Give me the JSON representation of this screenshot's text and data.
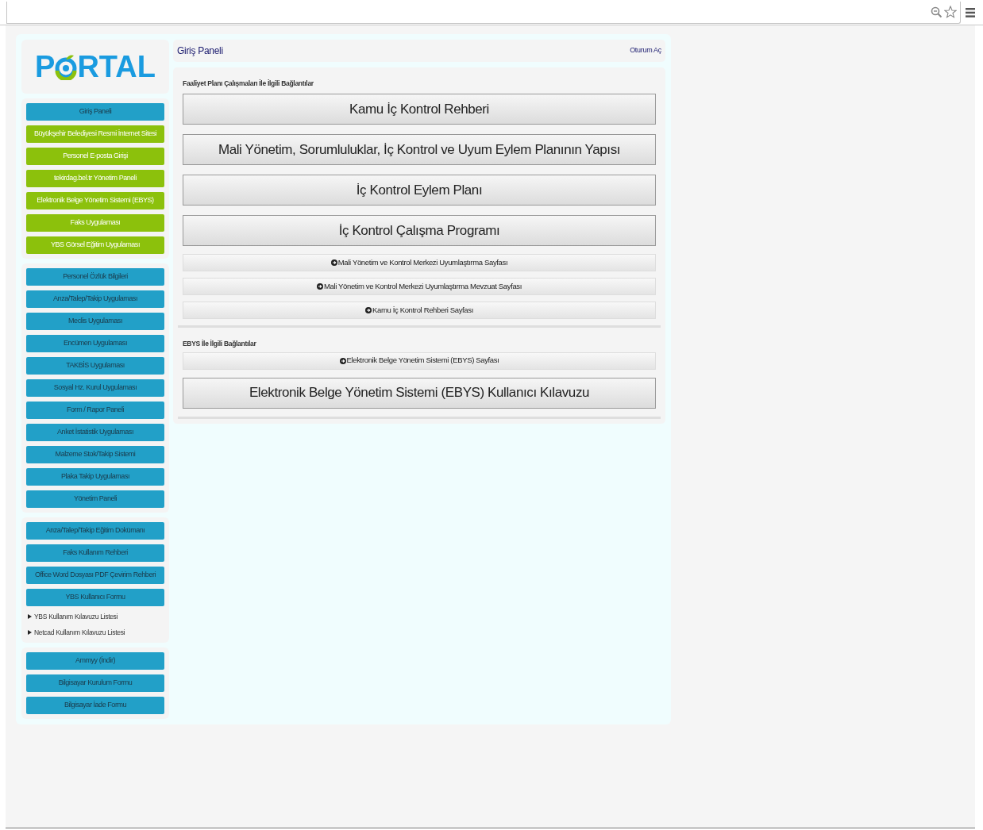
{
  "logo": {
    "parts": [
      "P",
      "RTAL"
    ]
  },
  "sidebar": {
    "groups": [
      {
        "items": [
          {
            "label": "Giriş Paneli",
            "kind": "button",
            "color": "#22a0c8"
          },
          {
            "label": "Büyükşehir Belediyesi Resmi İnternet Sitesi",
            "kind": "button",
            "color": "#8cc10c"
          },
          {
            "label": "Personel E-posta Girişi",
            "kind": "button",
            "color": "#8cc10c"
          },
          {
            "label": "tekirdag.bel.tr Yönetim Paneli",
            "kind": "button",
            "color": "#8cc10c"
          },
          {
            "label": "Elektronik Belge Yönetim Sistemi (EBYS)",
            "kind": "button",
            "color": "#8cc10c"
          },
          {
            "label": "Faks Uygulaması",
            "kind": "button",
            "color": "#8cc10c"
          },
          {
            "label": "YBS Görsel Eğitim Uygulaması",
            "kind": "button",
            "color": "#8cc10c"
          }
        ]
      },
      {
        "items": [
          {
            "label": "Personel Özlük Bilgileri",
            "kind": "button",
            "color": "#22a0c8"
          },
          {
            "label": "Arıza/Talep/Takip Uygulaması",
            "kind": "button",
            "color": "#22a0c8"
          },
          {
            "label": "Meclis Uygulaması",
            "kind": "button",
            "color": "#22a0c8"
          },
          {
            "label": "Encümen Uygulaması",
            "kind": "button",
            "color": "#22a0c8"
          },
          {
            "label": "TAKBİS Uygulaması",
            "kind": "button",
            "color": "#22a0c8"
          },
          {
            "label": "Sosyal Hz. Kurul Uygulaması",
            "kind": "button",
            "color": "#22a0c8"
          },
          {
            "label": "Form / Rapor Paneli",
            "kind": "button",
            "color": "#22a0c8"
          },
          {
            "label": "Anket İstatistik Uygulaması",
            "kind": "button",
            "color": "#22a0c8"
          },
          {
            "label": "Malzeme Stok/Takip Sistemi",
            "kind": "button",
            "color": "#22a0c8"
          },
          {
            "label": "Plaka Takip Uygulaması",
            "kind": "button",
            "color": "#22a0c8"
          },
          {
            "label": "Yönetim Paneli",
            "kind": "button",
            "color": "#22a0c8"
          }
        ]
      },
      {
        "items": [
          {
            "label": "Arıza/Talep/Takip Eğitim Dokümanı",
            "kind": "button",
            "color": "#22a0c8"
          },
          {
            "label": "Faks Kullanım Rehberi",
            "kind": "button",
            "color": "#22a0c8"
          },
          {
            "label": "Office Word Dosyası PDF Çevirim Rehberi",
            "kind": "button",
            "color": "#22a0c8"
          },
          {
            "label": "YBS Kullanıcı Formu",
            "kind": "button",
            "color": "#22a0c8"
          },
          {
            "label": "YBS Kullanım Kılavuzu Listesi",
            "kind": "toggle",
            "expanded": false
          },
          {
            "label": "Netcad Kullanım Kılavuzu Listesi",
            "kind": "toggle",
            "expanded": false
          }
        ]
      },
      {
        "items": [
          {
            "label": "Ammyy (İndir)",
            "kind": "button",
            "color": "#22a0c8"
          },
          {
            "label": "Bilgisayar Kurulum Formu",
            "kind": "button",
            "color": "#22a0c8"
          },
          {
            "label": "Bilgisayar İade Formu",
            "kind": "button",
            "color": "#22a0c8"
          }
        ]
      }
    ]
  },
  "header": {
    "title": "Giriş Paneli",
    "link": "Oturum Aç"
  },
  "sections": [
    {
      "heading": "Faaliyet Planı Çalışmaları İle İlgili Bağlantılar",
      "links": [
        {
          "label": "Kamu İç Kontrol Rehberi",
          "kind": "large"
        },
        {
          "label": "Mali Yönetim, Sorumluluklar, İç Kontrol ve Uyum Eylem Planının Yapısı",
          "kind": "large"
        },
        {
          "label": "İç Kontrol Eylem Planı",
          "kind": "large"
        },
        {
          "label": "İç Kontrol Çalışma Programı",
          "kind": "large"
        },
        {
          "label": "Mali Yönetim ve Kontrol Merkezi Uyumlaştırma Sayfası",
          "kind": "small"
        },
        {
          "label": "Mali Yönetim ve Kontrol Merkezi Uyumlaştırma Mevzuat Sayfası",
          "kind": "small"
        },
        {
          "label": "Kamu İç Kontrol Rehberi Sayfası",
          "kind": "small"
        }
      ]
    },
    {
      "heading": "EBYS İle İlgili Bağlantılar",
      "links": [
        {
          "label": "Elektronik Belge Yönetim Sistemi (EBYS) Sayfası",
          "kind": "small"
        },
        {
          "label": "Elektronik Belge Yönetim Sistemi (EBYS) Kullanıcı Kılavuzu",
          "kind": "large"
        }
      ]
    }
  ]
}
